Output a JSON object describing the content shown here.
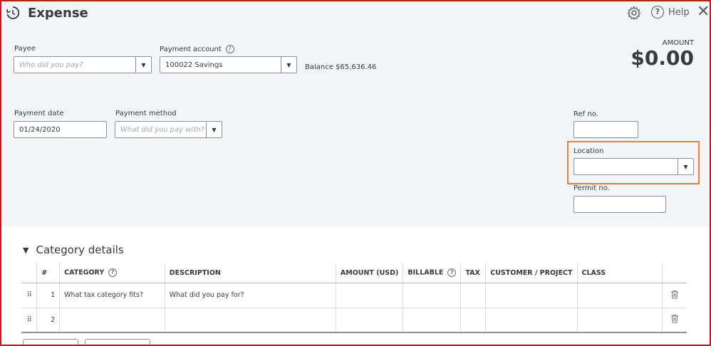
{
  "header": {
    "title": "Expense",
    "help_label": "Help"
  },
  "amount": {
    "label": "AMOUNT",
    "value": "$0.00"
  },
  "payee": {
    "label": "Payee",
    "placeholder": "Who did you pay?"
  },
  "payment_account": {
    "label": "Payment account",
    "value": "100022 Savings",
    "balance": "Balance $65,636.46"
  },
  "payment_date": {
    "label": "Payment date",
    "value": "01/24/2020"
  },
  "payment_method": {
    "label": "Payment method",
    "placeholder": "What did you pay with?"
  },
  "ref_no": {
    "label": "Ref no.",
    "value": ""
  },
  "location": {
    "label": "Location",
    "value": ""
  },
  "permit_no": {
    "label": "Permit no.",
    "value": ""
  },
  "category_details": {
    "title": "Category details",
    "columns": [
      "#",
      "CATEGORY",
      "DESCRIPTION",
      "AMOUNT (USD)",
      "BILLABLE",
      "TAX",
      "CUSTOMER / PROJECT",
      "CLASS"
    ],
    "rows": [
      {
        "num": "1",
        "category": "What tax category fits?",
        "description": "What did you pay for?"
      },
      {
        "num": "2",
        "category": "",
        "description": ""
      }
    ]
  },
  "colors": {
    "highlight": "#e8823a",
    "frame": "#c41a1a",
    "background": "#f4f5f8"
  }
}
